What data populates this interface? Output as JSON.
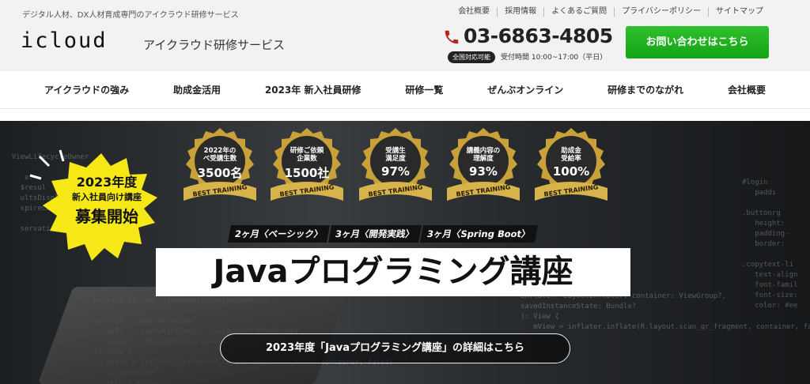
{
  "header": {
    "tagline": "デジタル人材、DX人材育成専門のアイクラウド研修サービス",
    "utility_links": [
      "会社概要",
      "採用情報",
      "よくあるご質問",
      "プライバシーポリシー",
      "サイトマップ"
    ],
    "logo": "icloud",
    "site_name": "アイクラウド研修サービス",
    "phone": "03-6863-4805",
    "phone_badge": "全国対応可能",
    "hours": "受付時間 10:00~17:00（平日）",
    "contact_button": "お問い合わせはこちら"
  },
  "nav": {
    "items": [
      "アイクラウドの強み",
      "助成金活用",
      "2023年 新入社員研修",
      "研修一覧",
      "ぜんぶオンライン",
      "研修までのながれ",
      "会社概要"
    ]
  },
  "hero": {
    "cta": {
      "line1": "2023年度",
      "line2": "新入社員向け講座",
      "line3": "募集開始"
    },
    "medals": [
      {
        "label": "2022年の\nべ受講生数",
        "value": "3500名",
        "band": "BEST TRAINING"
      },
      {
        "label": "研修ご依頼\n企業数",
        "value": "1500社",
        "band": "BEST TRAINING"
      },
      {
        "label": "受講生\n満足度",
        "value": "97%",
        "band": "BEST TRAINING"
      },
      {
        "label": "講義内容の\n理解度",
        "value": "93%",
        "band": "BEST TRAINING"
      },
      {
        "label": "助成金\n受給率",
        "value": "100%",
        "band": "BEST TRAINING"
      }
    ],
    "courses": [
      "2ヶ月〈ベーシック〉",
      "3ヶ月〈開発実践〉",
      "3ヶ月〈Spring Boot〉"
    ],
    "title": "Javaプログラミング講座",
    "detail_button": "2023年度「Javaプログラミング講座」の詳細はこちら",
    "colors": {
      "contact_green": "#1aaf1a",
      "medal_gold": "#c9a13a",
      "medal_dark": "#2a2a2a"
    }
  }
}
